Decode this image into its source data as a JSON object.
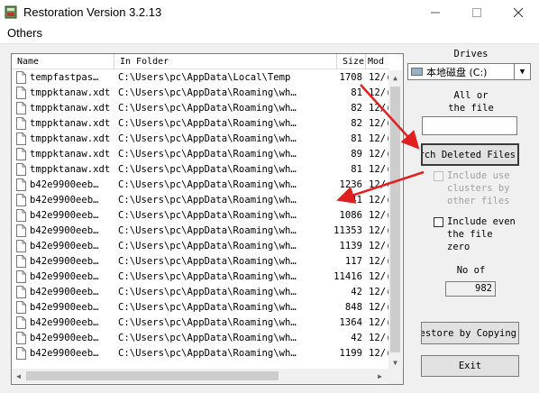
{
  "window": {
    "title": "Restoration Version 3.2.13"
  },
  "menu": {
    "items": [
      "Others"
    ]
  },
  "table": {
    "columns": [
      "Name",
      "In Folder",
      "Size",
      "Mod"
    ],
    "rows": [
      {
        "name": "tempfastpas…",
        "folder": "C:\\Users\\pc\\AppData\\Local\\Temp",
        "size": "1708",
        "mod": "12/("
      },
      {
        "name": "tmppktanaw.xdt",
        "folder": "C:\\Users\\pc\\AppData\\Roaming\\wh…",
        "size": "81",
        "mod": "12/("
      },
      {
        "name": "tmppktanaw.xdt",
        "folder": "C:\\Users\\pc\\AppData\\Roaming\\wh…",
        "size": "82",
        "mod": "12/("
      },
      {
        "name": "tmppktanaw.xdt",
        "folder": "C:\\Users\\pc\\AppData\\Roaming\\wh…",
        "size": "82",
        "mod": "12/("
      },
      {
        "name": "tmppktanaw.xdt",
        "folder": "C:\\Users\\pc\\AppData\\Roaming\\wh…",
        "size": "81",
        "mod": "12/("
      },
      {
        "name": "tmppktanaw.xdt",
        "folder": "C:\\Users\\pc\\AppData\\Roaming\\wh…",
        "size": "89",
        "mod": "12/("
      },
      {
        "name": "tmppktanaw.xdt",
        "folder": "C:\\Users\\pc\\AppData\\Roaming\\wh…",
        "size": "81",
        "mod": "12/("
      },
      {
        "name": "b42e9900eeb…",
        "folder": "C:\\Users\\pc\\AppData\\Roaming\\wh…",
        "size": "1236",
        "mod": "12/("
      },
      {
        "name": "b42e9900eeb…",
        "folder": "C:\\Users\\pc\\AppData\\Roaming\\wh…",
        "size": "41",
        "mod": "12/("
      },
      {
        "name": "b42e9900eeb…",
        "folder": "C:\\Users\\pc\\AppData\\Roaming\\wh…",
        "size": "1086",
        "mod": "12/("
      },
      {
        "name": "b42e9900eeb…",
        "folder": "C:\\Users\\pc\\AppData\\Roaming\\wh…",
        "size": "11353",
        "mod": "12/("
      },
      {
        "name": "b42e9900eeb…",
        "folder": "C:\\Users\\pc\\AppData\\Roaming\\wh…",
        "size": "1139",
        "mod": "12/("
      },
      {
        "name": "b42e9900eeb…",
        "folder": "C:\\Users\\pc\\AppData\\Roaming\\wh…",
        "size": "117",
        "mod": "12/("
      },
      {
        "name": "b42e9900eeb…",
        "folder": "C:\\Users\\pc\\AppData\\Roaming\\wh…",
        "size": "11416",
        "mod": "12/("
      },
      {
        "name": "b42e9900eeb…",
        "folder": "C:\\Users\\pc\\AppData\\Roaming\\wh…",
        "size": "42",
        "mod": "12/("
      },
      {
        "name": "b42e9900eeb…",
        "folder": "C:\\Users\\pc\\AppData\\Roaming\\wh…",
        "size": "848",
        "mod": "12/("
      },
      {
        "name": "b42e9900eeb…",
        "folder": "C:\\Users\\pc\\AppData\\Roaming\\wh…",
        "size": "1364",
        "mod": "12/("
      },
      {
        "name": "b42e9900eeb…",
        "folder": "C:\\Users\\pc\\AppData\\Roaming\\wh…",
        "size": "42",
        "mod": "12/("
      },
      {
        "name": "b42e9900eeb…",
        "folder": "C:\\Users\\pc\\AppData\\Roaming\\wh…",
        "size": "1199",
        "mod": "12/("
      }
    ]
  },
  "side": {
    "drives_label": "Drives",
    "drive_selected": "本地磁盘 (C:)",
    "all_or_label": "All or",
    "the_file_label": "the file",
    "file_input_value": "",
    "search_button": "Search Deleted Files",
    "include_clusters_lines": [
      "Include use",
      "clusters by",
      "other files"
    ],
    "include_zero_lines": [
      "Include even",
      "the file",
      "zero"
    ],
    "no_of_label": "No of",
    "count_value": "982",
    "restore_button": "Restore by Copying",
    "exit_button": "Exit"
  },
  "colors": {
    "annotation_arrow": "#e02020"
  }
}
